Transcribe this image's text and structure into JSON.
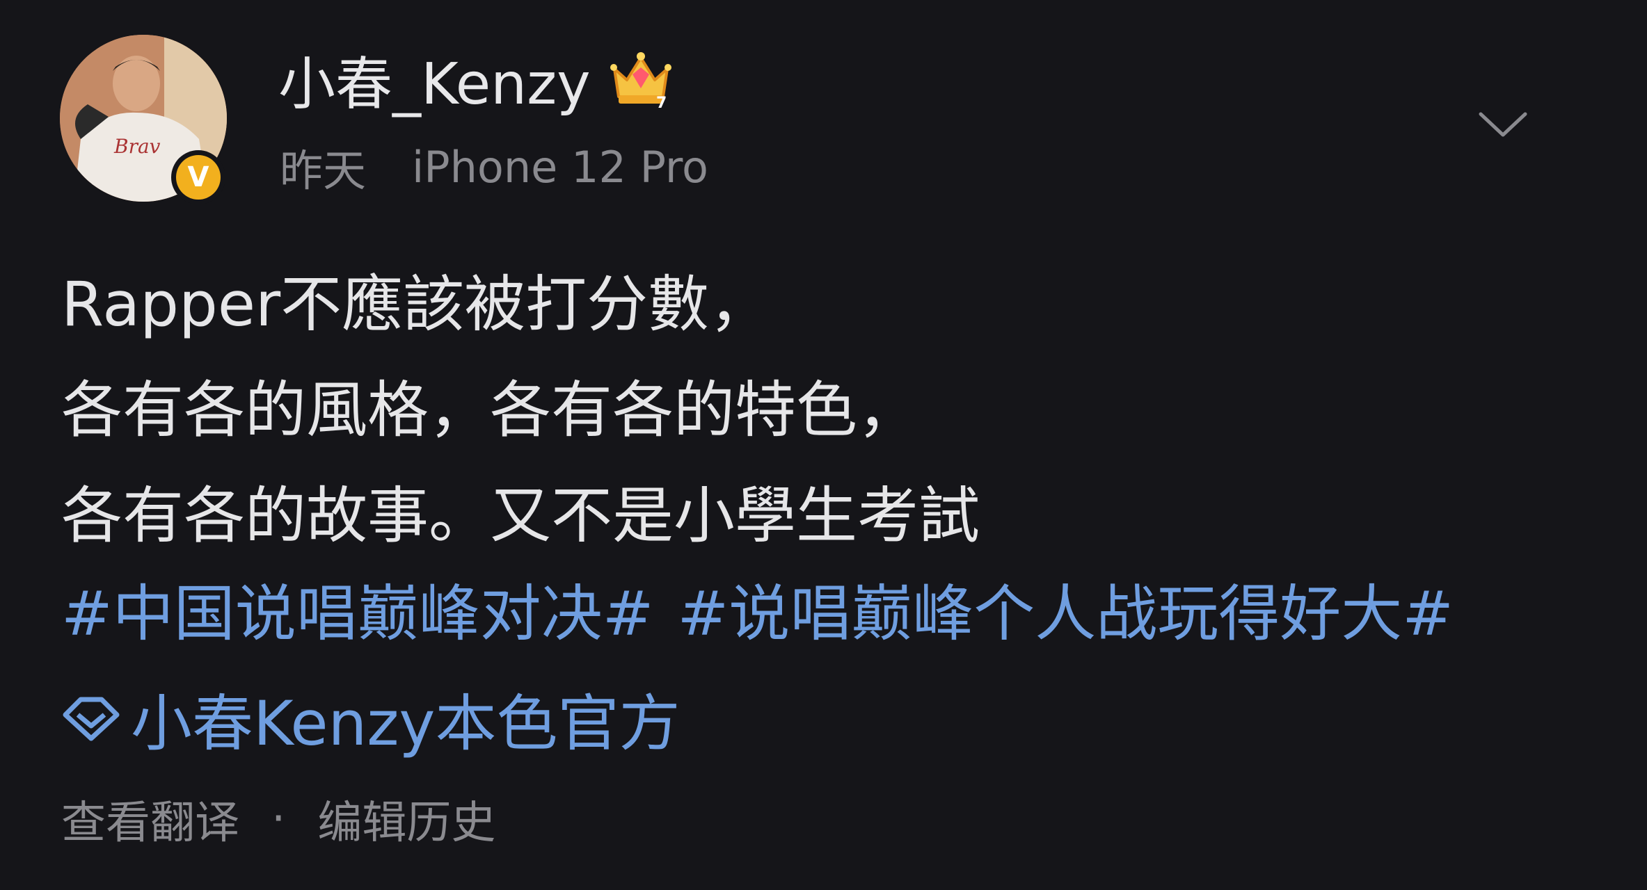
{
  "post": {
    "author": {
      "name": "小春_Kenzy",
      "verified_mark": "V",
      "crown_icon": "crown-icon"
    },
    "meta": {
      "time": "昨天",
      "source": "iPhone 12 Pro"
    },
    "content_lines": [
      "Rapper不應該被打分數，",
      "各有各的風格，各有各的特色，",
      "各有各的故事。又不是小學生考試"
    ],
    "hashtags": [
      "#中国说唱巅峰对决#",
      "#说唱巅峰个人战玩得好大#"
    ],
    "supertopic": {
      "icon": "diamond-icon",
      "label": "小春Kenzy本色官方"
    },
    "footer": {
      "translate": "查看翻译",
      "separator": "·",
      "edit_history": "编辑历史"
    }
  },
  "colors": {
    "background": "#151519",
    "text": "#e6e6e8",
    "muted": "#8a8a8f",
    "link": "#6f9ee0",
    "verified": "#f2b01e"
  }
}
